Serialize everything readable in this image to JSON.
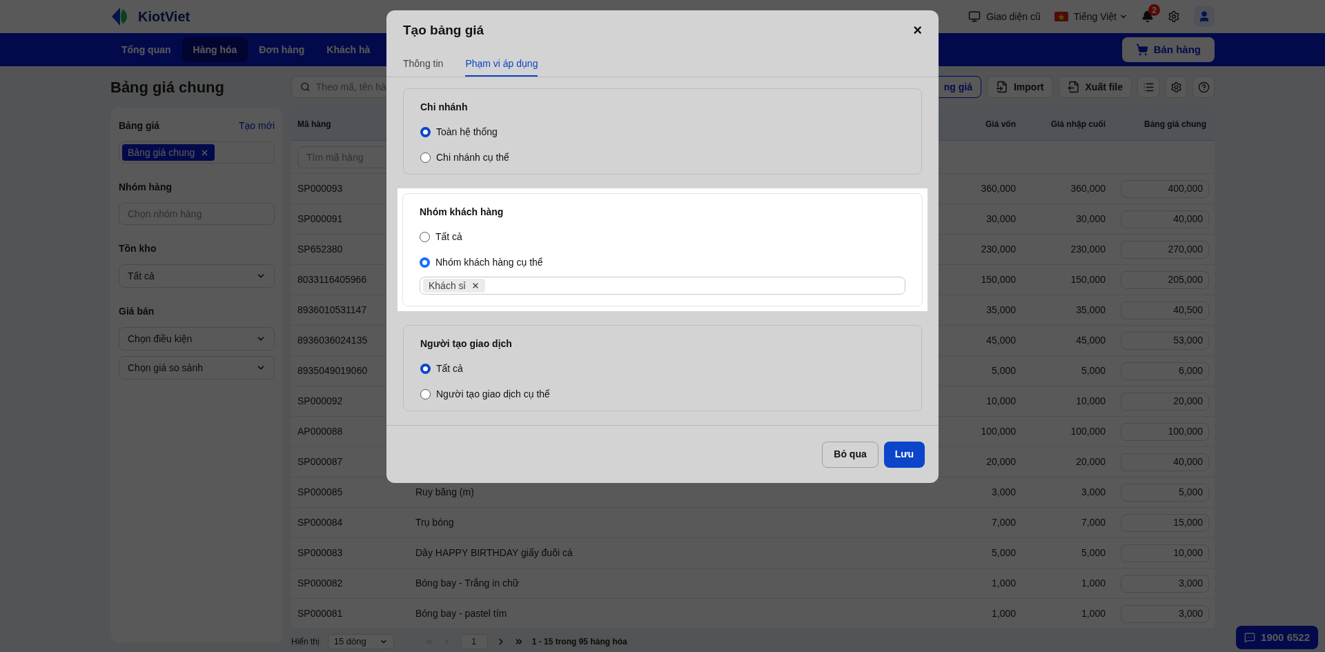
{
  "header": {
    "logo": "KiotViet",
    "old_ui": "Giao diện cũ",
    "language": "Tiếng Việt",
    "notification_count": "2"
  },
  "nav": {
    "items": [
      {
        "label": "Tổng quan",
        "selected": false
      },
      {
        "label": "Hàng hóa",
        "selected": true
      },
      {
        "label": "Đơn hàng",
        "selected": false
      },
      {
        "label": "Khách hà",
        "selected": false
      }
    ],
    "sell_button": "Bán hàng"
  },
  "page": {
    "title": "Bảng giá chung"
  },
  "sidebar": {
    "price_list": {
      "label": "Bảng giá",
      "link": "Tạo mới",
      "tag": "Bảng giá chung"
    },
    "groups": {
      "label": "Nhóm hàng",
      "placeholder": "Chọn nhóm hàng"
    },
    "stock": {
      "label": "Tồn kho",
      "value": "Tất cả"
    },
    "price": {
      "label": "Giá bán",
      "selects": [
        "Chọn điều kiện",
        "Chọn giá so sánh"
      ]
    }
  },
  "toolbar": {
    "search_placeholder": "Theo mã, tên hà",
    "buttons": [
      {
        "kind": "text",
        "label": "ng giá",
        "primary": true
      },
      {
        "kind": "import",
        "label": "Import"
      },
      {
        "kind": "export",
        "label": "Xuất file"
      },
      {
        "kind": "list"
      },
      {
        "kind": "settings"
      },
      {
        "kind": "help"
      }
    ]
  },
  "table": {
    "columns": [
      "Mã hàng",
      "Giá vốn",
      "Giá nhập cuối",
      "Bảng giá chung"
    ],
    "code_filter_placeholder": "Tìm mã hàng",
    "rows": [
      {
        "code": "SP000093",
        "cost": "360,000",
        "last_import": "360,000",
        "price": "400,000"
      },
      {
        "code": "SP000091",
        "cost": "30,000",
        "last_import": "30,000",
        "price": "40,000"
      },
      {
        "code": "SP652380",
        "cost": "230,000",
        "last_import": "230,000",
        "price": "270,000"
      },
      {
        "code": "8033116405966",
        "cost": "150,000",
        "last_import": "150,000",
        "price": "205,000"
      },
      {
        "code": "8936010531147",
        "cost": "35,000",
        "last_import": "35,000",
        "price": "40,500"
      },
      {
        "code": "8936036024135",
        "cost": "45,000",
        "last_import": "45,000",
        "price": "53,000"
      },
      {
        "code": "8935049019060",
        "cost": "5,000",
        "last_import": "5,000",
        "price": "6,000"
      },
      {
        "code": "SP000092",
        "cost": "10,000",
        "last_import": "10,000",
        "price": "20,000"
      },
      {
        "code": "AP000088",
        "cost": "100,000",
        "last_import": "100,000",
        "price": "100,000"
      },
      {
        "code": "SP000087",
        "cost": "20,000",
        "last_import": "20,000",
        "price": "40,000"
      },
      {
        "code": "SP000085",
        "name": "Ruy băng (m)",
        "cost": "3,000",
        "last_import": "3,000",
        "price": "5,000"
      },
      {
        "code": "SP000084",
        "name": "Trụ bóng",
        "cost": "7,000",
        "last_import": "7,000",
        "price": "15,000"
      },
      {
        "code": "SP000083",
        "name": "Dây HAPPY BIRTHDAY giấy đuôi cá",
        "cost": "5,000",
        "last_import": "5,000",
        "price": "10,000"
      },
      {
        "code": "SP000082",
        "name": "Bóng bay - Trắng in chữ",
        "cost": "1,000",
        "last_import": "1,000",
        "price": "3,000"
      },
      {
        "code": "SP000081",
        "name": "Bóng bay - pastel tím",
        "cost": "1,000",
        "last_import": "1,000",
        "price": "3,000"
      }
    ]
  },
  "pagination": {
    "label": "Hiển thị",
    "page_size": "15 dòng",
    "page": "1",
    "first_disabled": true,
    "prev_disabled": true,
    "summary": "1 - 15 trong 95 hàng hóa"
  },
  "hotline": "1900 6522",
  "modal": {
    "title": "Tạo bảng giá",
    "close": "×",
    "tabs": [
      {
        "label": "Thông tin",
        "selected": false
      },
      {
        "label": "Phạm vi áp dụng",
        "selected": true
      }
    ],
    "sections": [
      {
        "title": "Chi nhánh",
        "highlighted": false,
        "options": [
          {
            "label": "Toàn hệ thống",
            "selected": true
          },
          {
            "label": "Chi nhánh cụ thể",
            "selected": false
          }
        ]
      },
      {
        "title": "Nhóm khách hàng",
        "highlighted": true,
        "options": [
          {
            "label": "Tất cả",
            "selected": false
          },
          {
            "label": "Nhóm khách hàng cụ thể",
            "selected": true
          }
        ],
        "tags": [
          "Khách sỉ"
        ]
      },
      {
        "title": "Người tạo giao dịch",
        "highlighted": false,
        "options": [
          {
            "label": "Tất cả",
            "selected": true
          },
          {
            "label": "Người tạo giao dịch cụ thể",
            "selected": false
          }
        ]
      }
    ],
    "buttons": [
      {
        "label": "Bỏ qua",
        "primary": false
      },
      {
        "label": "Lưu",
        "primary": true
      }
    ]
  }
}
